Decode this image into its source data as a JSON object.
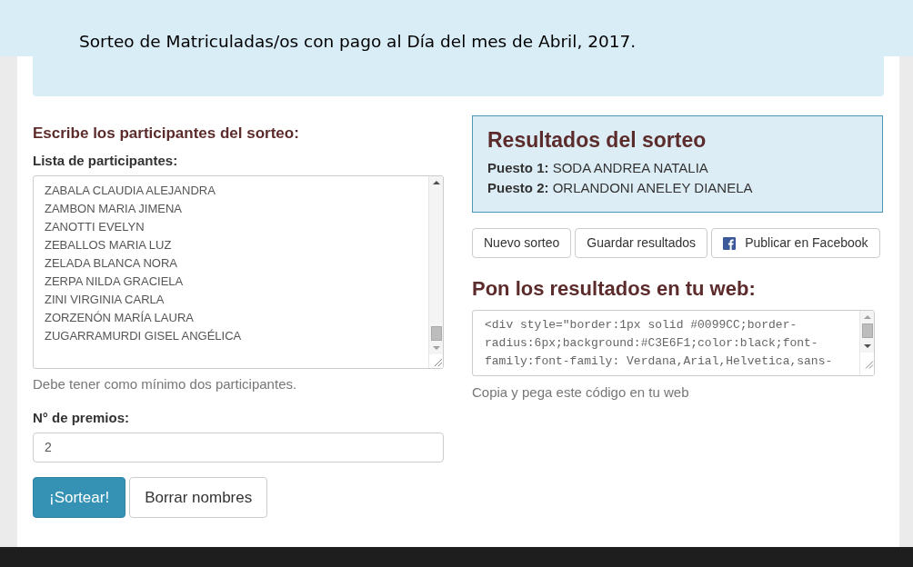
{
  "banner": {
    "text": "Sorteo de Matriculadas/os con pago al Día del mes de Abril, 2017."
  },
  "entry": {
    "heading": "Escribe los participantes del sorteo:",
    "list_label": "Lista de participantes:",
    "participants": [
      "ZABALA CLAUDIA ALEJANDRA",
      "ZAMBON MARIA JIMENA",
      "ZANOTTI EVELYN",
      "ZEBALLOS MARIA LUZ",
      "ZELADA BLANCA NORA",
      "ZERPA NILDA GRACIELA",
      "ZINI VIRGINIA CARLA",
      "ZORZENÓN MARÍA LAURA",
      "ZUGARRAMURDI GISEL ANGÉLICA"
    ],
    "list_help": "Debe tener como mínimo dos participantes.",
    "prizes_label": "N° de premios:",
    "prizes_value": "2",
    "buttons": [
      {
        "label": "¡Sortear!",
        "kind": "primary"
      },
      {
        "label": "Borrar nombres",
        "kind": "default"
      }
    ]
  },
  "results": {
    "title": "Resultados del sorteo",
    "places": [
      "**Puesto 1:** SODA ANDREA NATALIA",
      "**Puesto 2:** ORLANDONI ANELEY DIANELA"
    ]
  },
  "actions": [
    {
      "label": "Nuevo sorteo",
      "kind": "plain"
    },
    {
      "label": "Guardar resultados",
      "kind": "plain"
    },
    {
      "label": "Publicar en Facebook",
      "kind": "facebook"
    }
  ],
  "embed": {
    "heading": "Pon los resultados en tu web:",
    "code_lines": [
      "<div style=\"border:1px solid #0099CC;border-",
      "radius:6px;background:#C3E6F1;color:black;font-",
      "family:font-family: Verdana,Arial,Helvetica,sans-"
    ],
    "help": "Copia y pega este código en tu web"
  }
}
